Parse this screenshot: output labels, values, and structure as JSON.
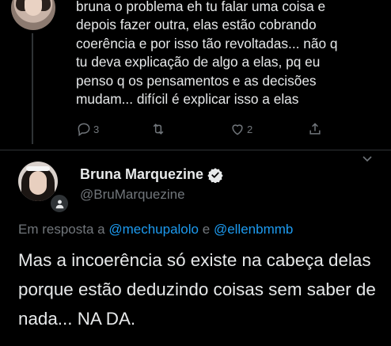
{
  "previous_tweet": {
    "text": "bruna o problema eh tu falar uma coisa e\ndepois fazer outra, elas estão cobrando\ncoerência e por isso tão revoltadas... não q\ntu deva explicação de algo a elas, pq eu\npenso q os pensamentos e as decisões\nmudam... difícil é explicar isso a elas",
    "reply_count": "3",
    "like_count": "2"
  },
  "main_tweet": {
    "display_name": "Bruna Marquezine",
    "handle": "@BruMarquezine",
    "reply_prefix": "Em resposta a",
    "mention_1": "@mechupalolo",
    "reply_joiner": "e",
    "mention_2": "@ellenbmmb",
    "text": "Mas a incoerência só existe na cabeça delas porque estão deduzindo coisas sem saber de nada... NA DA."
  },
  "colors": {
    "background": "#000000",
    "text": "#e7e9ea",
    "secondary": "#71767b",
    "accent": "#1d9bf0",
    "divider": "#2f3336"
  },
  "icons": [
    "reply-icon",
    "retweet-icon",
    "like-icon",
    "share-icon",
    "verified-icon",
    "chevron-down-icon",
    "protected-icon"
  ]
}
